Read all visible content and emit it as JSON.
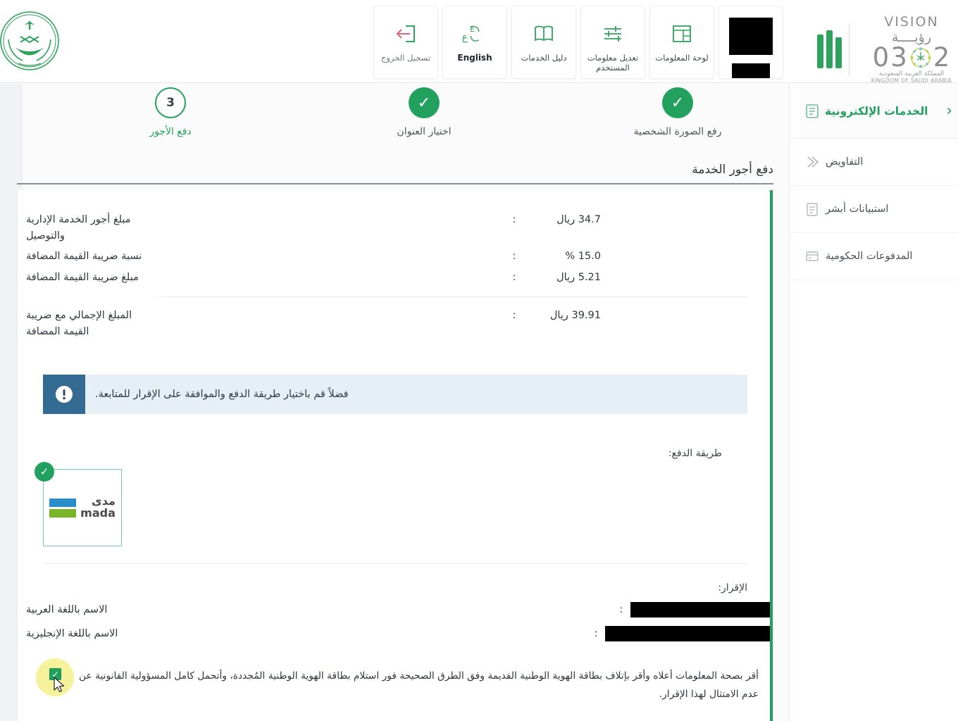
{
  "header": {
    "emblem_alt": "saudi-ministry-of-interior-emblem",
    "nav": [
      {
        "label": "تسجيل الخروج",
        "icon": "logout-icon"
      },
      {
        "label": "English",
        "icon": "language-icon"
      },
      {
        "label": "دليل الخدمات",
        "icon": "book-icon"
      },
      {
        "label": "تعديل معلومات المستخدم",
        "icon": "sliders-icon"
      },
      {
        "label": "لوحة المعلومات",
        "icon": "dashboard-icon"
      }
    ],
    "vision": {
      "word_en": "VISION",
      "word_ar": "رؤيــــة",
      "year": "2030",
      "kingdom_ar": "المملكة العربية السعودية",
      "kingdom_en": "KINGDOM OF SAUDI ARABIA"
    }
  },
  "sidebar": {
    "title": "الخدمات الإلكترونية",
    "back_icon": "chevron-left-icon",
    "items": [
      {
        "label": "التفاويض",
        "icon": "delegation-icon"
      },
      {
        "label": "استبيانات أبشر",
        "icon": "survey-icon"
      },
      {
        "label": "المدفوعات الحكومية",
        "icon": "payments-icon"
      }
    ]
  },
  "stepper": {
    "steps": [
      {
        "label": "رفع الصورة الشخصية",
        "state": "done",
        "mark": "✓"
      },
      {
        "label": "اختيار العنوان",
        "state": "done",
        "mark": "✓"
      },
      {
        "label": "دفع الأجور",
        "state": "active",
        "mark": "3"
      }
    ]
  },
  "panel": {
    "title": "دفع أجور الخدمة",
    "fees": [
      {
        "label": "مبلغ أجور الخدمة الإدارية والتوصيل",
        "colon": ":",
        "value": "34.7 ريال"
      },
      {
        "label": "نسبة ضريبة القيمة المضافة",
        "colon": ":",
        "value": "15.0 %"
      },
      {
        "label": "مبلغ ضريبة القيمة المضافة",
        "colon": ":",
        "value": "5.21 ريال"
      }
    ],
    "total": {
      "label": "المبلغ الإجمالي مع ضريبة القيمة المضافة",
      "colon": ":",
      "value": "39.91 ريال"
    },
    "alert": {
      "text": "فضلاً قم باختيار طريقة الدفع والموافقة على الإقرار للمتابعة.",
      "icon": "exclamation-icon"
    },
    "payment": {
      "label": "طريقة الدفع:",
      "selected_check": "✓",
      "card": {
        "name_ar": "مدى",
        "name_en": "mada"
      }
    },
    "declaration": {
      "label": "الإقرار:",
      "rows": [
        {
          "label": "الاسم باللغة العربية",
          "colon": ":",
          "value": ""
        },
        {
          "label": "الاسم باللغة الإنجليزية",
          "colon": ":",
          "value": ""
        }
      ],
      "consent_checked": "✓",
      "consent_text": "أقر بصحة المعلومات أعلاه وأقر بإتلاف بطاقة الهوية الوطنية القديمة وفق الطرق الصحيحة فور استلام بطاقة الهوية الوطنية المُجددة، وأتحمل كامل المسؤولية القانونية عن عدم الامتثال لهذا الإقرار."
    }
  },
  "colors": {
    "brand_green": "#21a05e",
    "alert_bg": "#e6eef6",
    "alert_icon_bg": "#336b93",
    "mada_blue": "#2a8cc8",
    "mada_green": "#7ab528",
    "highlight_yellow": "#f5f08a"
  }
}
